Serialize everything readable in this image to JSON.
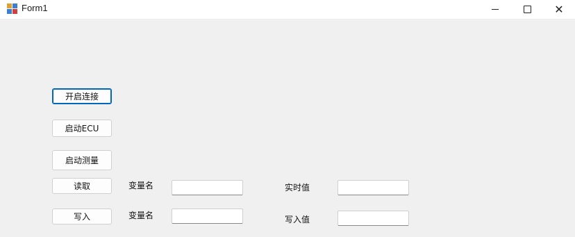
{
  "window": {
    "title": "Form1",
    "controls": {
      "minimize": "minimize-icon",
      "maximize": "maximize-icon",
      "close": "close-icon"
    }
  },
  "buttons": {
    "connect": "开启连接",
    "start_ecu": "启动ECU",
    "start_measure": "启动测量",
    "read": "读取",
    "write": "写入"
  },
  "labels": {
    "read_var_name": "变量名",
    "realtime_value": "实时值",
    "write_var_name": "变量名",
    "write_value": "写入值"
  },
  "fields": {
    "read_var_name_value": "",
    "realtime_value_value": "",
    "write_var_name_value": "",
    "write_value_value": ""
  },
  "colors": {
    "background": "#f0f0f0",
    "focus_accent": "#0067c0"
  }
}
